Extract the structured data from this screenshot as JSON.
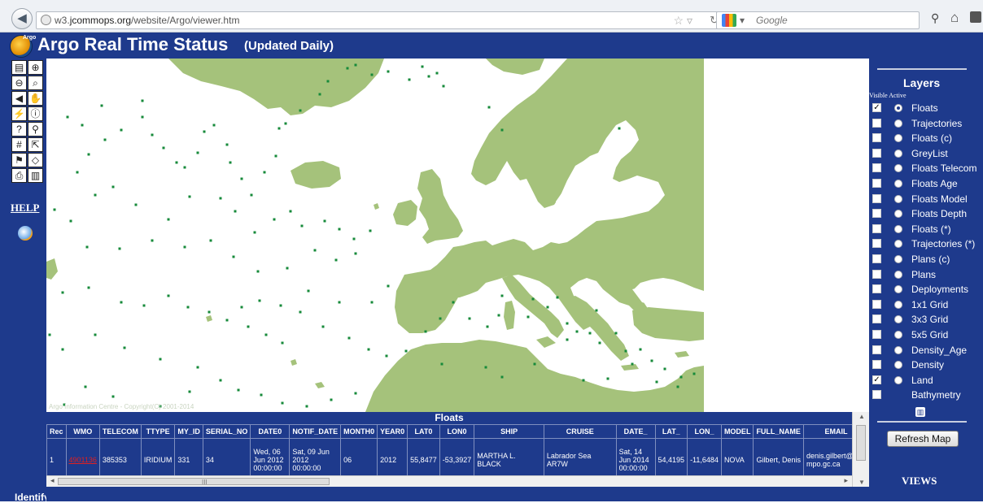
{
  "browser": {
    "url_prefix": "w3.",
    "url_host": "jcommops.org",
    "url_path": "/website/Argo/viewer.htm",
    "search_placeholder": "Google"
  },
  "header": {
    "logo_text": "Argo",
    "title": "Argo Real Time Status",
    "subtitle": "(Updated Daily)"
  },
  "left_panel": {
    "help_label": "HELP",
    "identify_label": "Identify",
    "tools": [
      {
        "name": "legend-tool-icon",
        "glyph": "▤"
      },
      {
        "name": "zoom-in-icon",
        "glyph": "⊕"
      },
      {
        "name": "zoom-out-icon",
        "glyph": "⊖"
      },
      {
        "name": "zoom-box-icon",
        "glyph": "⌕"
      },
      {
        "name": "back-extent-icon",
        "glyph": "◀"
      },
      {
        "name": "pan-hand-icon",
        "glyph": "✋"
      },
      {
        "name": "lightning-icon",
        "glyph": "⚡"
      },
      {
        "name": "info-icon",
        "glyph": "ⓘ"
      },
      {
        "name": "query-icon",
        "glyph": "?"
      },
      {
        "name": "binoculars-icon",
        "glyph": "⚲"
      },
      {
        "name": "grid-icon",
        "glyph": "#"
      },
      {
        "name": "select-icon",
        "glyph": "⇱"
      },
      {
        "name": "measure-icon",
        "glyph": "⚑"
      },
      {
        "name": "eraser-icon",
        "glyph": "◇"
      },
      {
        "name": "print-icon",
        "glyph": "⎙"
      },
      {
        "name": "book-icon",
        "glyph": "▥"
      }
    ]
  },
  "map": {
    "copyright": "Argo Information Centre - Copyright(C) 2001-2014",
    "land_color": "#a5c27b",
    "float_color": "#168a3a"
  },
  "table": {
    "title": "Floats",
    "columns": [
      "Rec",
      "WMO",
      "TELECOM",
      "TTYPE",
      "MY_ID",
      "SERIAL_NO",
      "DATE0",
      "NOTIF_DATE",
      "MONTH0",
      "YEAR0",
      "LAT0",
      "LON0",
      "SHIP",
      "CRUISE",
      "DATE_",
      "LAT_",
      "LON_",
      "MODEL",
      "FULL_NAME",
      "EMAIL"
    ],
    "rows": [
      {
        "Rec": "1",
        "WMO": "4901136",
        "TELECOM": "385353",
        "TTYPE": "IRIDIUM",
        "MY_ID": "331",
        "SERIAL_NO": "34",
        "DATE0": "Wed, 06 Jun 2012 00:00:00",
        "NOTIF_DATE": "Sat, 09 Jun 2012 00:00:00",
        "MONTH0": "06",
        "YEAR0": "2012",
        "LAT0": "55,8477",
        "LON0": "-53,3927",
        "SHIP": "MARTHA L. BLACK",
        "CRUISE": "Labrador Sea AR7W",
        "DATE_": "Sat, 14 Jun 2014 00:00:00",
        "LAT_": "54,4195",
        "LON_": "-11,6484",
        "MODEL": "NOVA",
        "FULL_NAME": "Gilbert, Denis",
        "EMAIL": "denis.gilbert@dfo-mpo.gc.ca"
      }
    ]
  },
  "right_panel": {
    "layers_title": "Layers",
    "visible_active": "Visible Active",
    "layers": [
      {
        "label": "Floats",
        "visible": true,
        "active": true
      },
      {
        "label": "Trajectories",
        "visible": false,
        "active": false
      },
      {
        "label": "Floats (c)",
        "visible": false,
        "active": false
      },
      {
        "label": "GreyList",
        "visible": false,
        "active": false
      },
      {
        "label": "Floats Telecom",
        "visible": false,
        "active": false
      },
      {
        "label": "Floats Age",
        "visible": false,
        "active": false
      },
      {
        "label": "Floats Model",
        "visible": false,
        "active": false
      },
      {
        "label": "Floats Depth",
        "visible": false,
        "active": false
      },
      {
        "label": "Floats (*)",
        "visible": false,
        "active": false
      },
      {
        "label": "Trajectories (*)",
        "visible": false,
        "active": false
      },
      {
        "label": "Plans (c)",
        "visible": false,
        "active": false
      },
      {
        "label": "Plans",
        "visible": false,
        "active": false
      },
      {
        "label": "Deployments",
        "visible": false,
        "active": false
      },
      {
        "label": "1x1 Grid",
        "visible": false,
        "active": false
      },
      {
        "label": "3x3 Grid",
        "visible": false,
        "active": false
      },
      {
        "label": "5x5 Grid",
        "visible": false,
        "active": false
      },
      {
        "label": "Density_Age",
        "visible": false,
        "active": false
      },
      {
        "label": "Density",
        "visible": false,
        "active": false
      },
      {
        "label": "Land",
        "visible": true,
        "active": false
      },
      {
        "label": "Bathymetry",
        "visible": false,
        "active": null
      }
    ],
    "refresh_label": "Refresh Map",
    "views_label": "VIEWS"
  }
}
